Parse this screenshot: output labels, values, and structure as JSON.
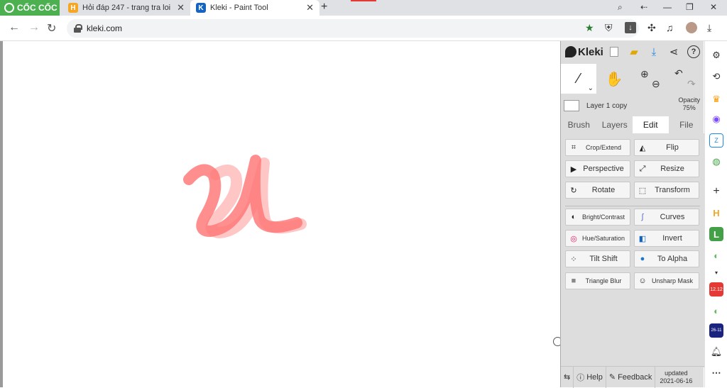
{
  "browser": {
    "brand": "CỐC CỐC",
    "tabs": [
      {
        "title": "Hỏi đáp 247 - trang tra loi",
        "favicon": "H"
      },
      {
        "title": "Kleki - Paint Tool",
        "favicon": "K"
      }
    ],
    "address": "kleki.com"
  },
  "kleki": {
    "logo": "Kleki",
    "layer": {
      "name": "Layer 1 copy",
      "opacity_label": "Opacity",
      "opacity_value": "75%"
    },
    "tabs": [
      "Brush",
      "Layers",
      "Edit",
      "File"
    ],
    "active_tab": "Edit",
    "edit_buttons": [
      {
        "label": "Crop/Extend",
        "icon": "crop-icon"
      },
      {
        "label": "Flip",
        "icon": "flip-icon"
      },
      {
        "label": "Perspective",
        "icon": "perspective-icon"
      },
      {
        "label": "Resize",
        "icon": "resize-icon"
      },
      {
        "label": "Rotate",
        "icon": "rotate-icon"
      },
      {
        "label": "Transform",
        "icon": "transform-icon"
      },
      {
        "label": "Bright/Contrast",
        "icon": "brightness-icon"
      },
      {
        "label": "Curves",
        "icon": "curves-icon"
      },
      {
        "label": "Hue/Saturation",
        "icon": "hue-icon"
      },
      {
        "label": "Invert",
        "icon": "invert-icon"
      },
      {
        "label": "Tilt Shift",
        "icon": "tilt-shift-icon"
      },
      {
        "label": "To Alpha",
        "icon": "to-alpha-icon"
      },
      {
        "label": "Triangle Blur",
        "icon": "blur-icon"
      },
      {
        "label": "Unsharp Mask",
        "icon": "unsharp-icon"
      }
    ],
    "footer": {
      "help": "Help",
      "feedback": "Feedback",
      "updated_label": "updated",
      "updated_date": "2021-06-16"
    }
  },
  "sidebar": {
    "date_badge_1": "12.12",
    "date_badge_2": "26-11"
  },
  "colors": {
    "accent": "#4caf50",
    "stroke": "#ff6b6b",
    "panel": "#dddddd"
  }
}
